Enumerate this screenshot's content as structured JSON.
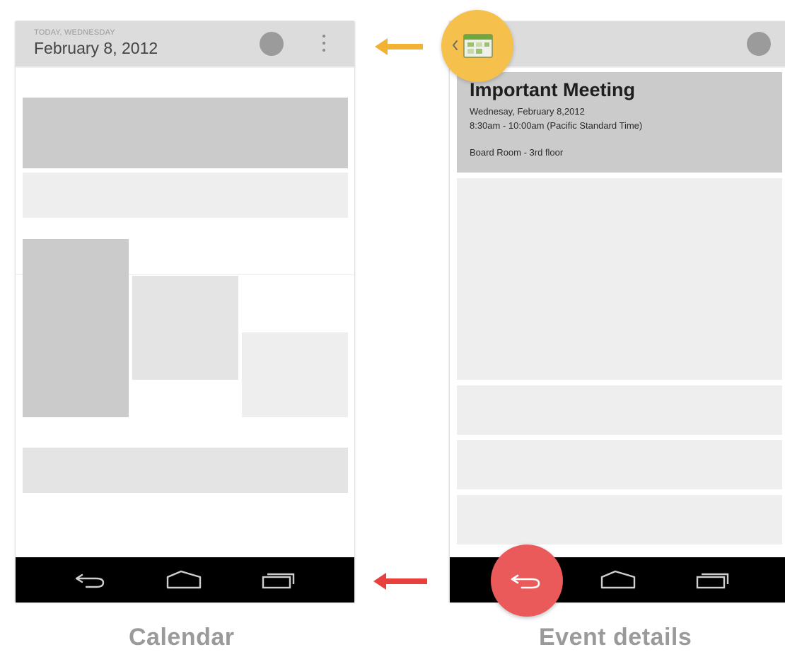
{
  "calendar_screen": {
    "today_label": "TODAY, WEDNESDAY",
    "date_title": "February 8, 2012"
  },
  "event_details_screen": {
    "event_title": "Important Meeting",
    "event_date": "Wednesay, February 8,2012",
    "event_time": "8:30am - 10:00am (Pacific Standard Time)",
    "event_location": "Board Room - 3rd floor"
  },
  "captions": {
    "left": "Calendar",
    "right": "Event details"
  },
  "colors": {
    "up_highlight": "#f5c04b",
    "up_arrow": "#f2b233",
    "back_highlight": "#ea5a5a",
    "back_arrow": "#e8403f",
    "action_bar": "#dcdcdc",
    "nav_bar": "#000000"
  },
  "icons": {
    "calendar_app": "calendar-app-icon",
    "up_caret": "chevron-left-icon",
    "back": "back-icon",
    "home": "home-icon",
    "recents": "recent-apps-icon",
    "overflow": "overflow-menu-icon"
  }
}
